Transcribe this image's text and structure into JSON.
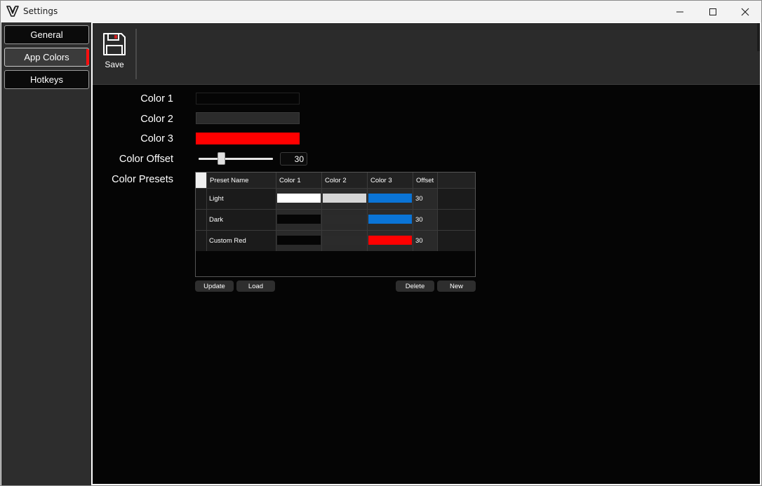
{
  "window": {
    "title": "Settings",
    "controls": {
      "minimize": "minimize",
      "maximize": "maximize",
      "close": "close"
    }
  },
  "sidebar": {
    "items": [
      {
        "label": "General",
        "active": false
      },
      {
        "label": "App Colors",
        "active": true
      },
      {
        "label": "Hotkeys",
        "active": false
      }
    ],
    "active_indicator_color": "#ff1010"
  },
  "toolbar": {
    "save_label": "Save",
    "save_icon": "floppy-disk-icon"
  },
  "form": {
    "color1": {
      "label": "Color 1",
      "value": "#050505"
    },
    "color2": {
      "label": "Color 2",
      "value": "#2b2b2b"
    },
    "color3": {
      "label": "Color 3",
      "value": "#ff0000"
    },
    "offset": {
      "label": "Color Offset",
      "value": "30",
      "level": 0.3
    },
    "presets_label": "Color Presets"
  },
  "presets": {
    "columns": [
      "Preset Name",
      "Color 1",
      "Color 2",
      "Color 3",
      "Offset"
    ],
    "rows": [
      {
        "name": "Light",
        "color1": "#ffffff",
        "color2": "#d6d6d6",
        "color3": "#0a74d6",
        "offset": "30"
      },
      {
        "name": "Dark",
        "color1": "#050505",
        "color2": "#2b2b2b",
        "color3": "#0a74d6",
        "offset": "30"
      },
      {
        "name": "Custom Red",
        "color1": "#050505",
        "color2": "#2b2b2b",
        "color3": "#ff0000",
        "offset": "30"
      }
    ],
    "buttons": {
      "update": "Update",
      "load": "Load",
      "delete": "Delete",
      "new": "New"
    }
  }
}
